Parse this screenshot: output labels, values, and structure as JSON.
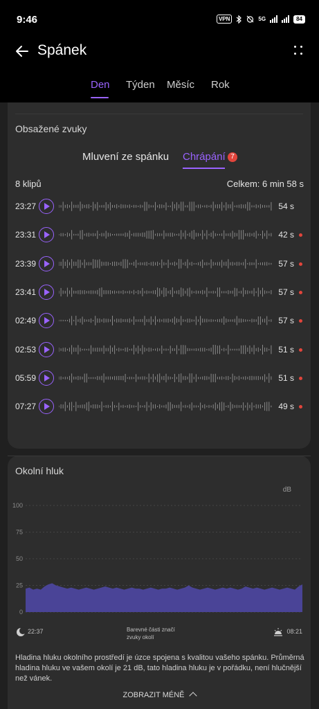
{
  "status": {
    "time": "9:46",
    "vpn": "VPN",
    "network": "5G",
    "battery": "84"
  },
  "header": {
    "title": "Spánek"
  },
  "period_tabs": [
    {
      "label": "Den",
      "active": true
    },
    {
      "label": "Týden",
      "active": false
    },
    {
      "label": "Měsíc",
      "active": false
    },
    {
      "label": "Rok",
      "active": false
    }
  ],
  "sounds": {
    "title": "Obsažené zvuky",
    "tabs": [
      {
        "label": "Mluvení ze spánku",
        "active": false
      },
      {
        "label": "Chrápání",
        "active": true,
        "badge": "7"
      }
    ],
    "count_label": "8 klipů",
    "total_label": "Celkem: 6 min 58 s",
    "clips": [
      {
        "time": "23:27",
        "duration": "54 s",
        "marked": false
      },
      {
        "time": "23:31",
        "duration": "42 s",
        "marked": true
      },
      {
        "time": "23:39",
        "duration": "57 s",
        "marked": true
      },
      {
        "time": "23:41",
        "duration": "57 s",
        "marked": true
      },
      {
        "time": "02:49",
        "duration": "57 s",
        "marked": true
      },
      {
        "time": "02:53",
        "duration": "51 s",
        "marked": true
      },
      {
        "time": "05:59",
        "duration": "51 s",
        "marked": true
      },
      {
        "time": "07:27",
        "duration": "49 s",
        "marked": true
      }
    ]
  },
  "noise": {
    "title": "Okolní hluk",
    "unit": "dB",
    "sleep_start": "22:37",
    "sleep_end": "08:21",
    "legend_note": "Barevné části značí zvuky okolí",
    "info": "Hladina hluku okolního prostředí je úzce spojena s kvalitou vašeho spánku. Průměrná hladina hluku ve vašem okolí je 21 dB, tato hladina hluku je v pořádku, není hlučnější než vánek.",
    "show_less": "ZOBRAZIT MÉNĚ"
  },
  "chart_data": {
    "type": "area",
    "title": "",
    "xlabel": "",
    "ylabel": "dB",
    "ylim": [
      0,
      100
    ],
    "yticks": [
      "100",
      "75",
      "50",
      "25",
      "0"
    ],
    "x_range": [
      "22:37",
      "08:21"
    ],
    "series": [
      {
        "values": [
          22,
          23,
          21,
          22,
          21,
          24,
          26,
          27,
          25,
          24,
          23,
          22,
          23,
          22,
          21,
          22,
          23,
          22,
          21,
          22,
          23,
          24,
          23,
          22,
          23,
          22,
          21,
          22,
          23,
          22,
          22,
          21,
          22,
          23,
          22,
          21,
          22,
          22,
          23,
          22,
          21,
          22,
          23,
          25,
          23,
          22,
          21,
          22,
          23,
          22,
          21,
          22,
          23,
          22,
          23,
          22,
          21,
          22,
          24,
          23,
          22,
          23,
          22,
          21,
          22,
          23,
          22,
          21,
          22,
          23,
          22,
          21,
          24,
          26
        ]
      }
    ],
    "color": "#4a4497",
    "grid": true
  },
  "colors": {
    "accent": "#9a63ff",
    "alert": "#e2453c",
    "area": "#4a4497"
  }
}
